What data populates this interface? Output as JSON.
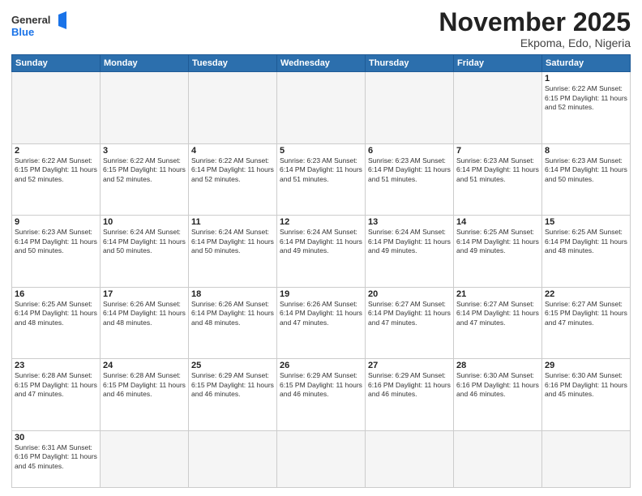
{
  "header": {
    "logo_general": "General",
    "logo_blue": "Blue",
    "month_title": "November 2025",
    "location": "Ekpoma, Edo, Nigeria"
  },
  "days": [
    "Sunday",
    "Monday",
    "Tuesday",
    "Wednesday",
    "Thursday",
    "Friday",
    "Saturday"
  ],
  "cells": [
    [
      {
        "date": "",
        "info": ""
      },
      {
        "date": "",
        "info": ""
      },
      {
        "date": "",
        "info": ""
      },
      {
        "date": "",
        "info": ""
      },
      {
        "date": "",
        "info": ""
      },
      {
        "date": "",
        "info": ""
      },
      {
        "date": "1",
        "info": "Sunrise: 6:22 AM\nSunset: 6:15 PM\nDaylight: 11 hours\nand 52 minutes."
      }
    ],
    [
      {
        "date": "2",
        "info": "Sunrise: 6:22 AM\nSunset: 6:15 PM\nDaylight: 11 hours\nand 52 minutes."
      },
      {
        "date": "3",
        "info": "Sunrise: 6:22 AM\nSunset: 6:15 PM\nDaylight: 11 hours\nand 52 minutes."
      },
      {
        "date": "4",
        "info": "Sunrise: 6:22 AM\nSunset: 6:14 PM\nDaylight: 11 hours\nand 52 minutes."
      },
      {
        "date": "5",
        "info": "Sunrise: 6:23 AM\nSunset: 6:14 PM\nDaylight: 11 hours\nand 51 minutes."
      },
      {
        "date": "6",
        "info": "Sunrise: 6:23 AM\nSunset: 6:14 PM\nDaylight: 11 hours\nand 51 minutes."
      },
      {
        "date": "7",
        "info": "Sunrise: 6:23 AM\nSunset: 6:14 PM\nDaylight: 11 hours\nand 51 minutes."
      },
      {
        "date": "8",
        "info": "Sunrise: 6:23 AM\nSunset: 6:14 PM\nDaylight: 11 hours\nand 50 minutes."
      }
    ],
    [
      {
        "date": "9",
        "info": "Sunrise: 6:23 AM\nSunset: 6:14 PM\nDaylight: 11 hours\nand 50 minutes."
      },
      {
        "date": "10",
        "info": "Sunrise: 6:24 AM\nSunset: 6:14 PM\nDaylight: 11 hours\nand 50 minutes."
      },
      {
        "date": "11",
        "info": "Sunrise: 6:24 AM\nSunset: 6:14 PM\nDaylight: 11 hours\nand 50 minutes."
      },
      {
        "date": "12",
        "info": "Sunrise: 6:24 AM\nSunset: 6:14 PM\nDaylight: 11 hours\nand 49 minutes."
      },
      {
        "date": "13",
        "info": "Sunrise: 6:24 AM\nSunset: 6:14 PM\nDaylight: 11 hours\nand 49 minutes."
      },
      {
        "date": "14",
        "info": "Sunrise: 6:25 AM\nSunset: 6:14 PM\nDaylight: 11 hours\nand 49 minutes."
      },
      {
        "date": "15",
        "info": "Sunrise: 6:25 AM\nSunset: 6:14 PM\nDaylight: 11 hours\nand 48 minutes."
      }
    ],
    [
      {
        "date": "16",
        "info": "Sunrise: 6:25 AM\nSunset: 6:14 PM\nDaylight: 11 hours\nand 48 minutes."
      },
      {
        "date": "17",
        "info": "Sunrise: 6:26 AM\nSunset: 6:14 PM\nDaylight: 11 hours\nand 48 minutes."
      },
      {
        "date": "18",
        "info": "Sunrise: 6:26 AM\nSunset: 6:14 PM\nDaylight: 11 hours\nand 48 minutes."
      },
      {
        "date": "19",
        "info": "Sunrise: 6:26 AM\nSunset: 6:14 PM\nDaylight: 11 hours\nand 47 minutes."
      },
      {
        "date": "20",
        "info": "Sunrise: 6:27 AM\nSunset: 6:14 PM\nDaylight: 11 hours\nand 47 minutes."
      },
      {
        "date": "21",
        "info": "Sunrise: 6:27 AM\nSunset: 6:14 PM\nDaylight: 11 hours\nand 47 minutes."
      },
      {
        "date": "22",
        "info": "Sunrise: 6:27 AM\nSunset: 6:15 PM\nDaylight: 11 hours\nand 47 minutes."
      }
    ],
    [
      {
        "date": "23",
        "info": "Sunrise: 6:28 AM\nSunset: 6:15 PM\nDaylight: 11 hours\nand 47 minutes."
      },
      {
        "date": "24",
        "info": "Sunrise: 6:28 AM\nSunset: 6:15 PM\nDaylight: 11 hours\nand 46 minutes."
      },
      {
        "date": "25",
        "info": "Sunrise: 6:29 AM\nSunset: 6:15 PM\nDaylight: 11 hours\nand 46 minutes."
      },
      {
        "date": "26",
        "info": "Sunrise: 6:29 AM\nSunset: 6:15 PM\nDaylight: 11 hours\nand 46 minutes."
      },
      {
        "date": "27",
        "info": "Sunrise: 6:29 AM\nSunset: 6:16 PM\nDaylight: 11 hours\nand 46 minutes."
      },
      {
        "date": "28",
        "info": "Sunrise: 6:30 AM\nSunset: 6:16 PM\nDaylight: 11 hours\nand 46 minutes."
      },
      {
        "date": "29",
        "info": "Sunrise: 6:30 AM\nSunset: 6:16 PM\nDaylight: 11 hours\nand 45 minutes."
      }
    ],
    [
      {
        "date": "30",
        "info": "Sunrise: 6:31 AM\nSunset: 6:16 PM\nDaylight: 11 hours\nand 45 minutes."
      },
      {
        "date": "",
        "info": ""
      },
      {
        "date": "",
        "info": ""
      },
      {
        "date": "",
        "info": ""
      },
      {
        "date": "",
        "info": ""
      },
      {
        "date": "",
        "info": ""
      },
      {
        "date": "",
        "info": ""
      }
    ]
  ]
}
